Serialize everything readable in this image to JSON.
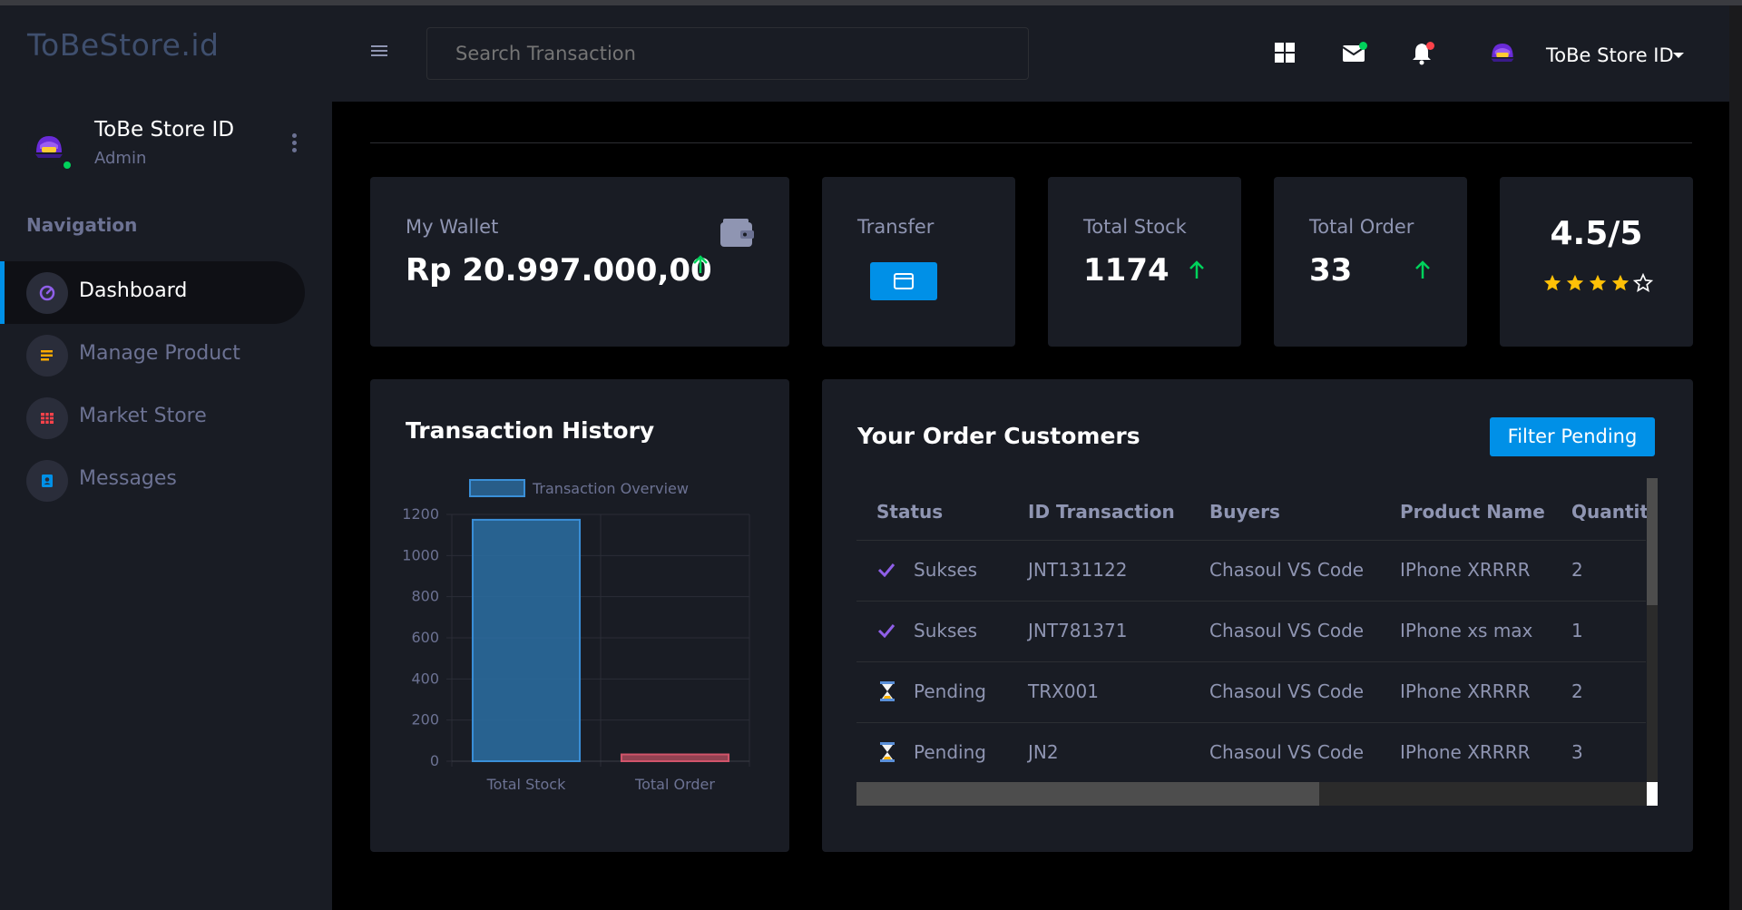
{
  "brand": "ToBeStore.id",
  "profile": {
    "name": "ToBe Store ID",
    "role": "Admin"
  },
  "nav": {
    "title": "Navigation",
    "items": [
      {
        "label": "Dashboard",
        "icon": "speedometer-icon",
        "color": "#8f5fe8"
      },
      {
        "label": "Manage Product",
        "icon": "playlist-icon",
        "color": "#ffab00"
      },
      {
        "label": "Market Store",
        "icon": "table-icon",
        "color": "#fc424a"
      },
      {
        "label": "Messages",
        "icon": "contacts-icon",
        "color": "#0090e7"
      }
    ]
  },
  "topbar": {
    "search_placeholder": "Search Transaction",
    "user_name": "ToBe Store ID"
  },
  "cards": {
    "wallet": {
      "label": "My Wallet",
      "value": "Rp 20.997.000,00"
    },
    "transfer": {
      "label": "Transfer"
    },
    "stock": {
      "label": "Total Stock",
      "value": "1174"
    },
    "order": {
      "label": "Total Order",
      "value": "33"
    },
    "rating": {
      "value": "4.5/5",
      "stars": 4.5
    }
  },
  "history": {
    "title": "Transaction History"
  },
  "chart_data": {
    "type": "bar",
    "categories": [
      "Total Stock",
      "Total Order"
    ],
    "series": [
      {
        "name": "Transaction Overview",
        "values": [
          1174,
          33
        ]
      }
    ],
    "colors": [
      "#2c6ea3",
      "#a8495a"
    ],
    "ylim": [
      0,
      1200
    ],
    "yticks": [
      0,
      200,
      400,
      600,
      800,
      1000,
      1200
    ],
    "legend": "top"
  },
  "orders": {
    "title": "Your Order Customers",
    "filter_label": "Filter Pending",
    "columns": [
      "Status",
      "ID Transaction",
      "Buyers",
      "Product Name",
      "Quantity"
    ],
    "rows": [
      {
        "status": "Sukses",
        "status_icon": "check-icon",
        "id": "JNT131122",
        "buyer": "Chasoul VS Code",
        "product": "IPhone XRRRR",
        "qty": "2"
      },
      {
        "status": "Sukses",
        "status_icon": "check-icon",
        "id": "JNT781371",
        "buyer": "Chasoul VS Code",
        "product": "IPhone xs max",
        "qty": "1"
      },
      {
        "status": "Pending",
        "status_icon": "hourglass-icon",
        "id": "TRX001",
        "buyer": "Chasoul VS Code",
        "product": "IPhone XRRRR",
        "qty": "2"
      },
      {
        "status": "Pending",
        "status_icon": "hourglass-icon",
        "id": "JN2",
        "buyer": "Chasoul VS Code",
        "product": "IPhone XRRRR",
        "qty": "3"
      }
    ]
  },
  "colors": {
    "accent": "#0090e7",
    "success": "#00d25b",
    "panel": "#191c24",
    "muted": "#8f95b2"
  }
}
